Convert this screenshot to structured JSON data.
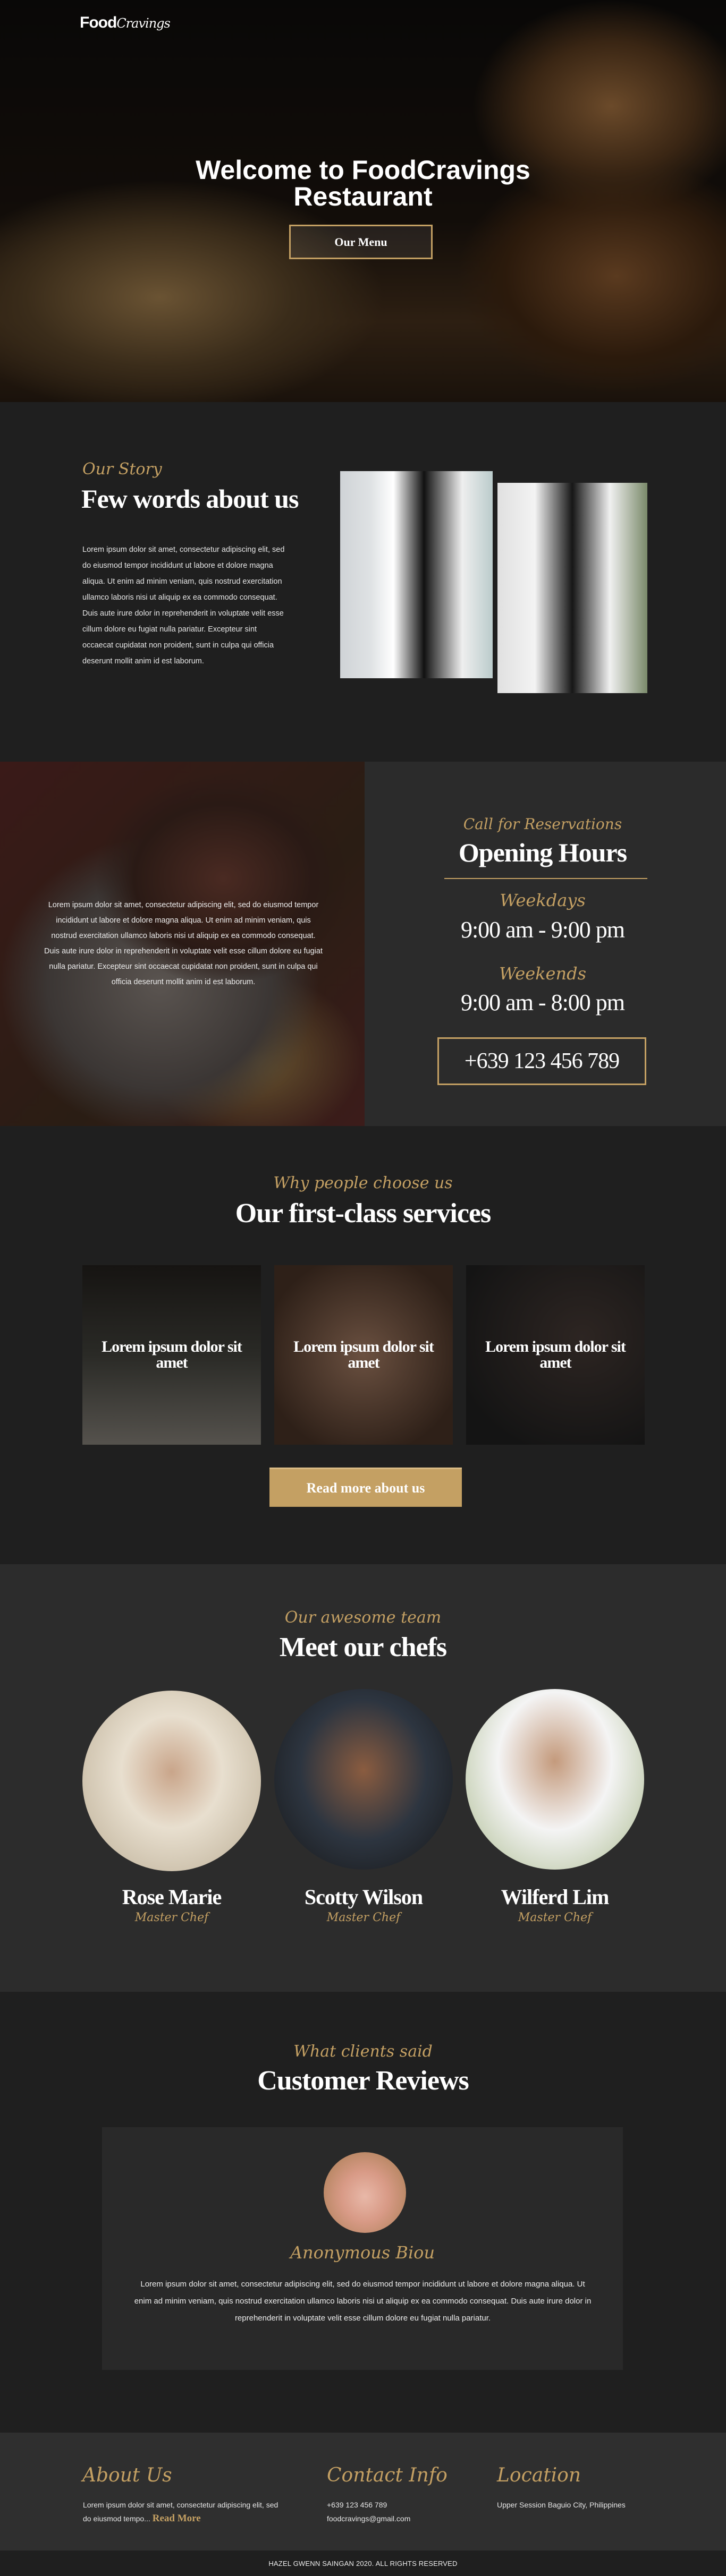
{
  "brand": {
    "logo_bold": "Food",
    "logo_script": "Cravings",
    "accent_color": "#c4a063"
  },
  "hero": {
    "title": "Welcome to FoodCravings Restaurant",
    "button": "Our Menu"
  },
  "about": {
    "eyebrow": "Our Story",
    "heading": "Few words about us",
    "text": "Lorem ipsum dolor sit amet, consectetur adipiscing elit, sed do eiusmod tempor incididunt ut labore et dolore magna aliqua. Ut enim ad minim veniam, quis nostrud exercitation ullamco laboris nisi ut aliquip ex ea commodo consequat. Duis aute irure dolor in reprehenderit in voluptate velit esse cillum dolore eu fugiat nulla pariatur. Excepteur sint occaecat cupidatat non proident, sunt in culpa qui officia deserunt mollit anim id est laborum."
  },
  "hours": {
    "overlay_text": "Lorem ipsum dolor sit amet, consectetur adipiscing elit, sed do eiusmod tempor incididunt ut labore et dolore magna aliqua. Ut enim ad minim veniam, quis nostrud exercitation ullamco laboris nisi ut aliquip ex ea commodo consequat. Duis aute irure dolor in reprehenderit in voluptate velit esse cillum dolore eu fugiat nulla pariatur. Excepteur sint occaecat cupidatat non proident, sunt in culpa qui officia deserunt mollit anim id est laborum.",
    "eyebrow": "Call for Reservations",
    "heading": "Opening Hours",
    "weekdays_label": "Weekdays",
    "weekdays_time": "9:00 am - 9:00 pm",
    "weekends_label": "Weekends",
    "weekends_time": "9:00 am - 8:00 pm",
    "phone": "+639 123 456 789"
  },
  "services": {
    "eyebrow": "Why people choose us",
    "heading": "Our first-class services",
    "cards": [
      {
        "title": "Lorem ipsum dolor sit amet"
      },
      {
        "title": "Lorem ipsum dolor sit amet"
      },
      {
        "title": "Lorem ipsum dolor sit amet"
      }
    ],
    "button": "Read more about us"
  },
  "team": {
    "eyebrow": "Our awesome team",
    "heading": "Meet our chefs",
    "chefs": [
      {
        "name": "Rose Marie",
        "role": "Master Chef"
      },
      {
        "name": "Scotty Wilson",
        "role": "Master Chef"
      },
      {
        "name": "Wilferd Lim",
        "role": "Master Chef"
      }
    ]
  },
  "reviews": {
    "eyebrow": "What clients said",
    "heading": "Customer Reviews",
    "reviewer": "Anonymous Biou",
    "text": "Lorem ipsum dolor sit amet, consectetur adipiscing elit, sed do eiusmod tempor incididunt ut labore et dolore magna aliqua. Ut enim ad minim veniam, quis nostrud exercitation ullamco laboris nisi ut aliquip ex ea commodo consequat. Duis aute irure dolor in reprehenderit in voluptate velit esse cillum dolore eu fugiat nulla pariatur."
  },
  "footer": {
    "about_title": "About Us",
    "about_text": "Lorem ipsum dolor sit amet, consectetur adipiscing elit, sed do eiusmod tempo...",
    "read_more": "Read More",
    "contact_title": "Contact Info",
    "phone": "+639 123 456 789",
    "email": "foodcravings@gmail.com",
    "location_title": "Location",
    "address": "Upper Session Baguio City, Philippines",
    "copyright": "HAZEL GWENN SAINGAN 2020. ALL RIGHTS RESERVED"
  }
}
